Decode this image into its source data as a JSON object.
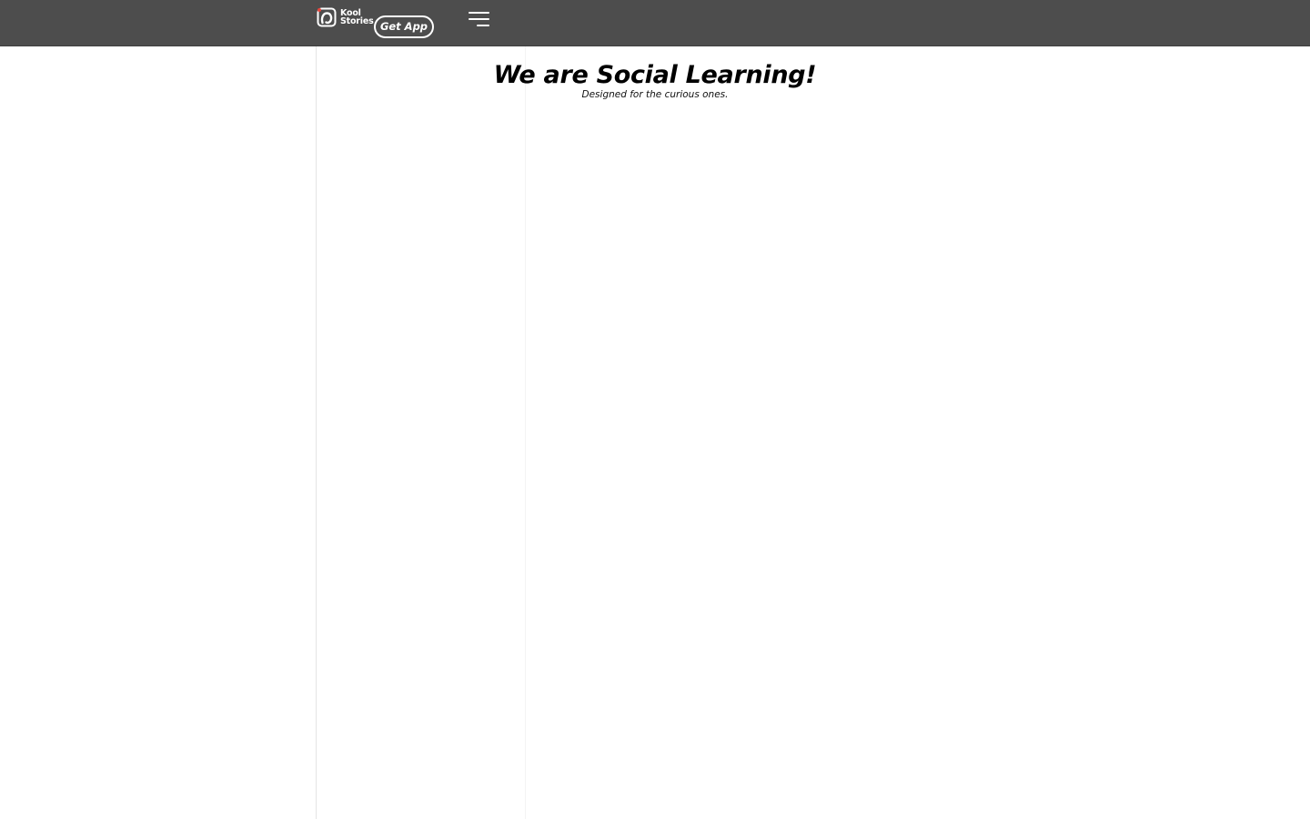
{
  "header": {
    "brand": {
      "line1": "Kool",
      "line2": "Stories",
      "icon": "koolstories-logo-icon",
      "accent_color": "#e8453c"
    },
    "get_app_label": "Get App",
    "menu_icon": "hamburger-menu-icon",
    "background_color": "#4d4d4d"
  },
  "hero": {
    "title": "We are Social Learning!",
    "subtitle": "Designed for the curious ones."
  }
}
